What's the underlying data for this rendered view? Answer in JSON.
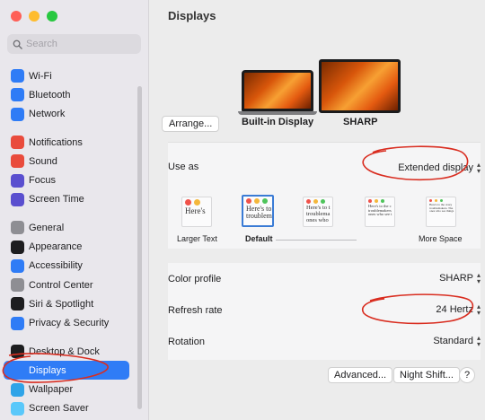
{
  "sidebar": {
    "search_placeholder": "Search",
    "groups": [
      [
        {
          "label": "Wi-Fi",
          "icon": "wifi-icon",
          "color": "#2f7cf6"
        },
        {
          "label": "Bluetooth",
          "icon": "bluetooth-icon",
          "color": "#2f7cf6"
        },
        {
          "label": "Network",
          "icon": "network-icon",
          "color": "#2f7cf6"
        }
      ],
      [
        {
          "label": "Notifications",
          "icon": "notifications-icon",
          "color": "#e94b3c"
        },
        {
          "label": "Sound",
          "icon": "sound-icon",
          "color": "#e94b3c"
        },
        {
          "label": "Focus",
          "icon": "focus-icon",
          "color": "#5a4fcf"
        },
        {
          "label": "Screen Time",
          "icon": "screen-time-icon",
          "color": "#5a4fcf"
        }
      ],
      [
        {
          "label": "General",
          "icon": "gear-icon",
          "color": "#8e8e93"
        },
        {
          "label": "Appearance",
          "icon": "appearance-icon",
          "color": "#1d1d1f"
        },
        {
          "label": "Accessibility",
          "icon": "accessibility-icon",
          "color": "#2f7cf6"
        },
        {
          "label": "Control Center",
          "icon": "control-center-icon",
          "color": "#8e8e93"
        },
        {
          "label": "Siri & Spotlight",
          "icon": "siri-icon",
          "color": "#1d1d1f"
        },
        {
          "label": "Privacy & Security",
          "icon": "hand-icon",
          "color": "#2f7cf6"
        }
      ],
      [
        {
          "label": "Desktop & Dock",
          "icon": "dock-icon",
          "color": "#1d1d1f"
        },
        {
          "label": "Displays",
          "icon": "displays-icon",
          "color": "#2f7cf6",
          "selected": true
        },
        {
          "label": "Wallpaper",
          "icon": "wallpaper-icon",
          "color": "#2fa4e8"
        },
        {
          "label": "Screen Saver",
          "icon": "screen-saver-icon",
          "color": "#5ac8fa"
        }
      ]
    ]
  },
  "main": {
    "title": "Displays",
    "arrange_label": "Arrange...",
    "displays": [
      {
        "label": "Built-in Display"
      },
      {
        "label": "SHARP",
        "selected": true
      }
    ],
    "use_as": {
      "label": "Use as",
      "value": "Extended display"
    },
    "resolution": {
      "options": [
        {
          "sample": [
            "Here's"
          ],
          "caption": "Larger Text"
        },
        {
          "sample": [
            "Here's to",
            "troublem"
          ],
          "caption": "Default",
          "selected": true
        },
        {
          "sample": [
            "Here's to t",
            "troublema",
            "ones who"
          ],
          "caption": ""
        },
        {
          "sample": [
            "Here's to the c",
            "troublemakers",
            "ones who see t"
          ],
          "caption": ""
        },
        {
          "sample": [
            "Here's to the crazy",
            "troublemakers. The",
            "ones who see things"
          ],
          "caption": "More Space"
        }
      ]
    },
    "color_profile": {
      "label": "Color profile",
      "value": "SHARP"
    },
    "refresh_rate": {
      "label": "Refresh rate",
      "value": "24 Hertz"
    },
    "rotation": {
      "label": "Rotation",
      "value": "Standard"
    },
    "buttons": {
      "advanced": "Advanced...",
      "night_shift": "Night Shift...",
      "help": "?"
    }
  },
  "colors": {
    "accent": "#2f7cf6",
    "annotation": "#d92d20"
  }
}
